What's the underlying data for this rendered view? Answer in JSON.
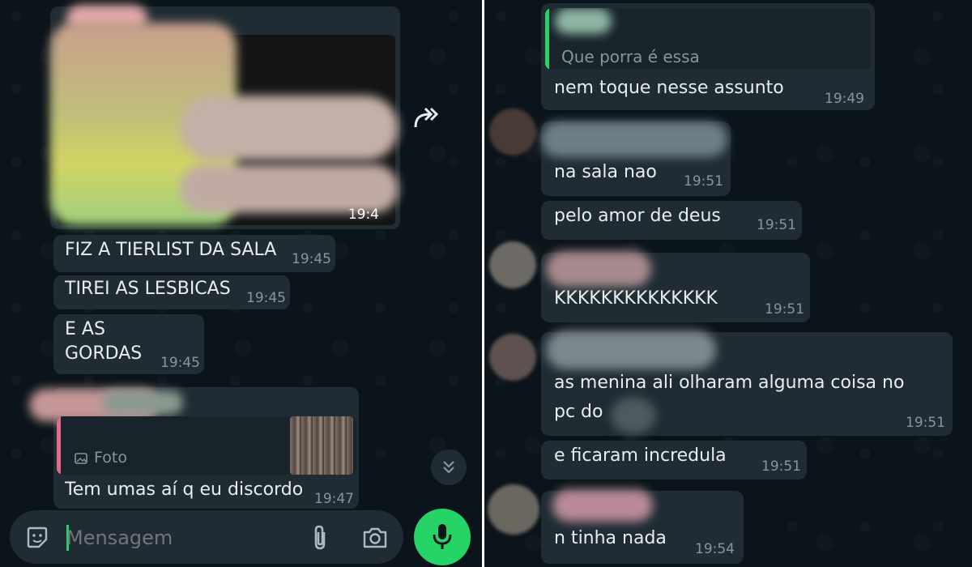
{
  "left": {
    "image_time": "19:4",
    "messages": [
      {
        "text": "FIZ A TIERLIST DA SALA",
        "time": "19:45"
      },
      {
        "text": "TIREI AS LESBICAS",
        "time": "19:45"
      },
      {
        "line1": "E AS",
        "line2": "GORDAS",
        "time": "19:45"
      },
      {
        "quote_label": "Foto",
        "text": "Tem umas aí q eu discordo",
        "time": "19:47"
      }
    ],
    "input": {
      "placeholder": "Mensagem"
    },
    "colors": {
      "accent": "#25d366",
      "bubble": "#1f2c33",
      "quote_bar": "#e26a8d"
    },
    "icons": [
      "sticker-icon",
      "attach-icon",
      "camera-icon",
      "mic-icon",
      "forward-icon",
      "scroll-down-icon",
      "image-icon"
    ]
  },
  "right": {
    "messages": [
      {
        "quote": "Que porra é essa",
        "text": "nem toque nesse assunto",
        "time": "19:49"
      },
      {
        "text": "na sala nao",
        "time": "19:51"
      },
      {
        "text": "pelo amor de deus",
        "time": "19:51"
      },
      {
        "text": "KKKKKKKKKKKKKK",
        "time": "19:51"
      },
      {
        "line1": "as menina ali olharam alguma coisa no",
        "line2": "pc do",
        "time": "19:51"
      },
      {
        "text": "e ficaram incredula",
        "time": "19:51"
      },
      {
        "text": "n tinha nada",
        "time": "19:54"
      }
    ],
    "colors": {
      "quote_bar": "#25d366"
    }
  }
}
